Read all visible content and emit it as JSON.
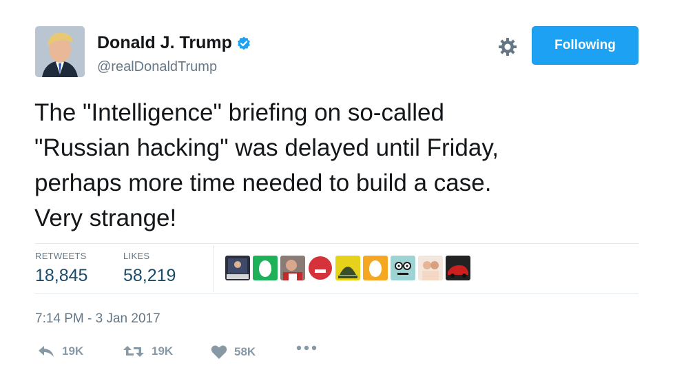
{
  "author": {
    "display_name": "Donald J. Trump",
    "handle": "@realDonaldTrump",
    "verified": true,
    "avatar_icon": "profile-photo"
  },
  "follow_button": {
    "label": "Following",
    "color": "#1da1f2"
  },
  "settings_icon": "gear-icon",
  "tweet": {
    "text": "The \"Intelligence\" briefing on so-called\n\"Russian hacking\" was delayed until Friday,\nperhaps more time needed to build a case.\nVery strange!"
  },
  "stats": {
    "retweets_label": "RETWEETS",
    "retweets_value": "18,845",
    "likes_label": "LIKES",
    "likes_value": "58,219"
  },
  "likers": [
    {
      "icon": "liker-avatar-1"
    },
    {
      "icon": "liker-avatar-2"
    },
    {
      "icon": "liker-avatar-3"
    },
    {
      "icon": "liker-avatar-4"
    },
    {
      "icon": "liker-avatar-5"
    },
    {
      "icon": "liker-avatar-6"
    },
    {
      "icon": "liker-avatar-7"
    },
    {
      "icon": "liker-avatar-8"
    },
    {
      "icon": "liker-avatar-9"
    }
  ],
  "timestamp": "7:14 PM - 3 Jan 2017",
  "actions": {
    "reply_count": "19K",
    "retweet_count": "19K",
    "like_count": "58K",
    "more_icon": "more-dots-icon"
  }
}
